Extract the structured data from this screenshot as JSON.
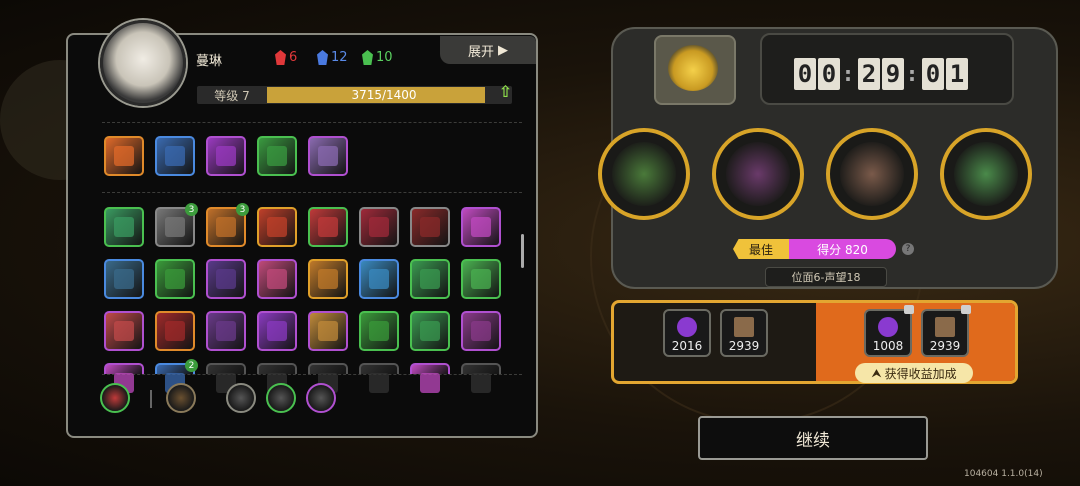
{
  "character": {
    "name": "蔓琳",
    "level_label": "等级 7",
    "exp_text": "3715/1400",
    "exp_progress": 0.93
  },
  "resources": [
    {
      "value": "6",
      "icon": "red-demon-icon",
      "color": "#e0383a"
    },
    {
      "value": "12",
      "icon": "blue-demon-icon",
      "color": "#4a7ae0"
    },
    {
      "value": "10",
      "icon": "green-demon-icon",
      "color": "#4ac050"
    }
  ],
  "expand_button": {
    "label": "展开",
    "icon": "play-arrow-icon"
  },
  "equipped_items": [
    {
      "icon": "fire-skill-icon",
      "border": "#e08a2a",
      "color": "#e06a2a"
    },
    {
      "icon": "lightning-shield-icon",
      "border": "#4a8ae0",
      "color": "#3a6ab0"
    },
    {
      "icon": "purple-claw-icon",
      "border": "#b050d0",
      "color": "#9a3ac0"
    },
    {
      "icon": "green-tree-icon",
      "border": "#4ac050",
      "color": "#3a9a40"
    },
    {
      "icon": "backpack-icon",
      "border": "#b050d0",
      "color": "#8a6ab0"
    }
  ],
  "skill_rows": [
    [
      {
        "icon": "green-wave-icon",
        "border": "#4ac050",
        "color": "#3a9a60"
      },
      {
        "icon": "gear-icon",
        "border": "#888",
        "color": "#777",
        "badge": "3"
      },
      {
        "icon": "orange-slash-icon",
        "border": "#e08a2a",
        "color": "#c0702a",
        "badge": "3"
      },
      {
        "icon": "golden-blade-icon",
        "border": "#e0a02a",
        "color": "#c0402a"
      },
      {
        "icon": "red-feather-icon",
        "border": "#4ac050",
        "color": "#c03a3a"
      },
      {
        "icon": "red-claws-icon",
        "border": "#888",
        "color": "#a02a3a"
      },
      {
        "icon": "red-tree-icon",
        "border": "#888",
        "color": "#8a2a2a"
      },
      {
        "icon": "purple-orb-icon",
        "border": "#b050d0",
        "color": "#c04ac0"
      }
    ],
    [
      {
        "icon": "fish-icon",
        "border": "#4a8ae0",
        "color": "#3a6a8a"
      },
      {
        "icon": "green-flame-icon",
        "border": "#4ac050",
        "color": "#3a9a3a"
      },
      {
        "icon": "shadow-figure-icon",
        "border": "#b050d0",
        "color": "#5a3a8a"
      },
      {
        "icon": "pink-rune-icon",
        "border": "#b050d0",
        "color": "#c04a7a"
      },
      {
        "icon": "golden-arch-icon",
        "border": "#e0a02a",
        "color": "#c07a2a"
      },
      {
        "icon": "blue-burst-icon",
        "border": "#4a8ae0",
        "color": "#3a8ac0"
      },
      {
        "icon": "green-diamond-icon",
        "border": "#4ac050",
        "color": "#3a9a50"
      },
      {
        "icon": "green-spikes-icon",
        "border": "#4ac050",
        "color": "#4ab050"
      }
    ],
    [
      {
        "icon": "crossed-x-icon",
        "border": "#b050d0",
        "color": "#c04a4a"
      },
      {
        "icon": "red-monster-icon",
        "border": "#e08a2a",
        "color": "#a02a2a"
      },
      {
        "icon": "thorn-ring-icon",
        "border": "#b050d0",
        "color": "#6a3a8a"
      },
      {
        "icon": "purple-shard-icon",
        "border": "#b050d0",
        "color": "#8a3ac0"
      },
      {
        "icon": "swirl-icon",
        "border": "#b050d0",
        "color": "#c08a3a"
      },
      {
        "icon": "up-arrow-icon",
        "border": "#4ac050",
        "color": "#3a9a3a"
      },
      {
        "icon": "heart-icon",
        "border": "#4ac050",
        "color": "#3a9a50"
      },
      {
        "icon": "purple-vortex-icon",
        "border": "#b050d0",
        "color": "#8a3a8a"
      }
    ],
    [
      {
        "icon": "pink-bubble-icon",
        "border": "#b050d0",
        "color": "#c04ac0"
      },
      {
        "icon": "blue-splash-icon",
        "border": "#4a8ae0",
        "color": "#3a6ab0",
        "badge": "2"
      },
      {
        "icon": "hidden-icon",
        "border": "#555",
        "color": "#333"
      },
      {
        "icon": "hidden-icon",
        "border": "#555",
        "color": "#333"
      },
      {
        "icon": "hidden-icon",
        "border": "#555",
        "color": "#333"
      },
      {
        "icon": "hidden-icon",
        "border": "#555",
        "color": "#333"
      },
      {
        "icon": "pink-crown-icon",
        "border": "#b050d0",
        "color": "#c04ac0"
      },
      {
        "icon": "hidden-icon",
        "border": "#555",
        "color": "#333"
      }
    ]
  ],
  "bottom_icons": [
    {
      "icon": "red-demon-filter-icon",
      "border": "#4ac050",
      "color": "#c03a3a"
    },
    {
      "icon": "brown-coin-icon",
      "border": "#8a7a5a",
      "color": "#6a5030"
    },
    {
      "icon": "eye-icon",
      "border": "#8a8a80",
      "color": "#555"
    },
    {
      "icon": "flask-icon",
      "border": "#4ac050",
      "color": "#555"
    },
    {
      "icon": "purple-check-icon",
      "border": "#b050d0",
      "color": "#555"
    }
  ],
  "timer": {
    "digits": [
      "0",
      "0",
      "2",
      "9",
      "0",
      "1"
    ]
  },
  "opponents": [
    {
      "icon": "insect-face-icon",
      "color": "#4a7a3a"
    },
    {
      "icon": "horned-monster-icon",
      "color": "#6a3a6a"
    },
    {
      "icon": "bird-knight-icon",
      "color": "#7a5a4a"
    },
    {
      "icon": "glasses-boy-icon",
      "color": "#4a8a4a"
    }
  ],
  "score": {
    "best_label": "最佳",
    "score_text": "得分 820",
    "help": "?"
  },
  "rank_text": "位面6-声望18",
  "rewards": {
    "current": [
      {
        "value": "2016",
        "icon": "purple-orb-icon",
        "color": "#8a3ad0"
      },
      {
        "value": "2939",
        "icon": "brown-block-icon",
        "color": "#8a6a4a"
      }
    ],
    "bonus": [
      {
        "value": "1008",
        "icon": "purple-orb-icon",
        "color": "#8a3ad0"
      },
      {
        "value": "2939",
        "icon": "brown-block-icon",
        "color": "#8a6a4a"
      }
    ],
    "bonus_label": "获得收益加成"
  },
  "continue_label": "继续",
  "version": "104604 1.1.0(14)"
}
